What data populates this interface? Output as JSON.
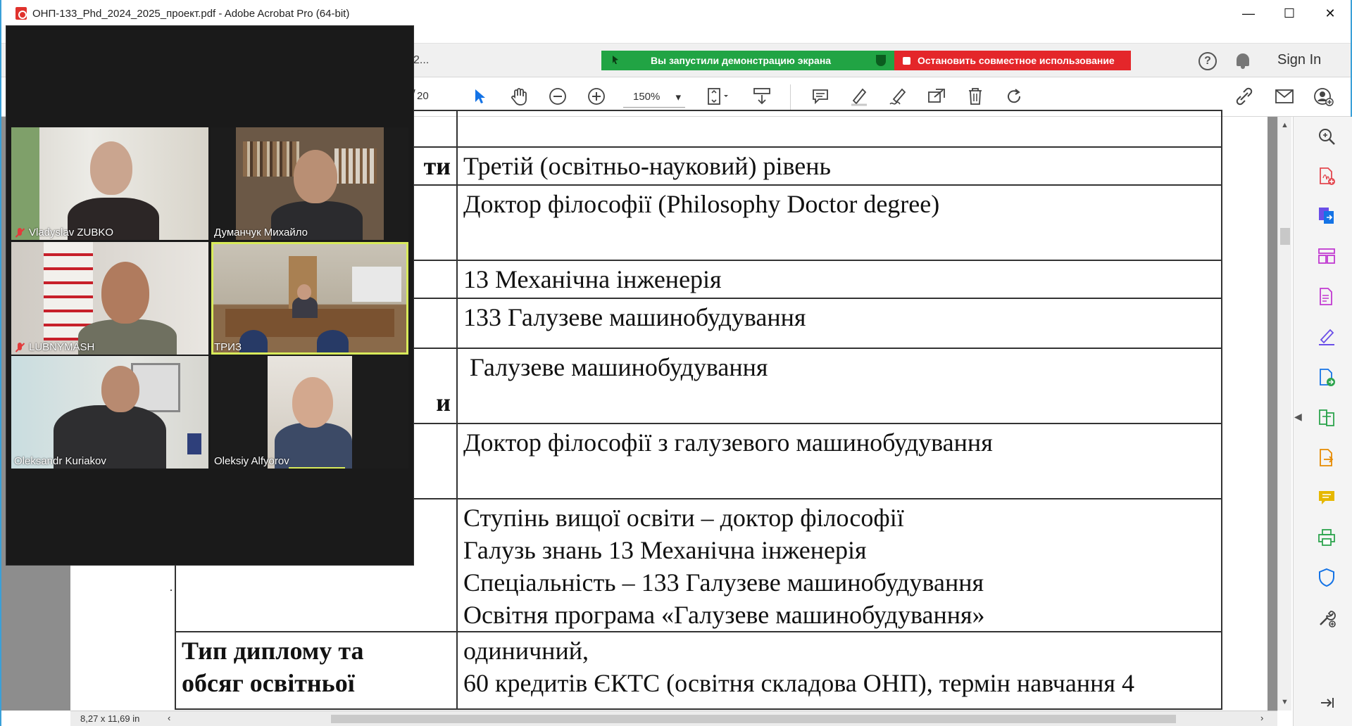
{
  "window": {
    "title": "ОНП-133_Phd_2024_2025_проект.pdf - Adobe Acrobat Pro (64-bit)",
    "minimize": "—",
    "maximize": "☐",
    "close": "✕"
  },
  "tabbar": {
    "doc_tab": "2...",
    "share_notice": "Вы запустили демонстрацию экрана",
    "stop_share": "Остановить совместное использование",
    "help": "?",
    "sign_in": "Sign In"
  },
  "toolbar": {
    "page_total": "20",
    "zoom_value": "150%",
    "zoom_arrow": "▾"
  },
  "document": {
    "rows": [
      {
        "left": "",
        "right": [
          ""
        ]
      },
      {
        "left": "ти",
        "right": [
          "Третій (освітньо-науковий) рівень"
        ]
      },
      {
        "left": "",
        "right": [
          "Доктор філософії (Philosophy Doctor degree)"
        ]
      },
      {
        "left": "",
        "right": [
          "13 Механічна інженерія"
        ]
      },
      {
        "left": "",
        "right": [
          "133 Галузеве машинобудування"
        ]
      },
      {
        "left": "и",
        "right": [
          " Галузеве машинобудування"
        ]
      },
      {
        "left": "",
        "right": [
          "Доктор філософії з галузевого машинобудування"
        ]
      },
      {
        "left": "",
        "right": [
          "Ступінь вищої освіти – доктор філософії",
          "Галузь знань 13 Механічна інженерія",
          "Спеціальність – 133 Галузеве машинобудування",
          "Освітня програма «Галузеве машинобудування»"
        ]
      },
      {
        "left_lines": [
          "Тип диплому та",
          "обсяг освітньої"
        ],
        "right": [
          "одиничний,",
          "60 кредитів ЄКТС (освітня складова ОНП), термін навчання 4"
        ]
      }
    ]
  },
  "statusbar": {
    "page_size": "8,27 x 11,69 in",
    "scroll_left": "‹",
    "scroll_right": "›"
  },
  "participants": [
    {
      "name": "Vladyslav ZUBKO",
      "muted": true
    },
    {
      "name": "Думанчук Михайло",
      "muted": false
    },
    {
      "name": "LUBNYMASH",
      "muted": true
    },
    {
      "name": "ТРИЗ",
      "muted": false,
      "active": true
    },
    {
      "name": "Oleksandr Kuriakov",
      "muted": false
    },
    {
      "name": "Oleksiy Alfyorov",
      "muted": false
    }
  ],
  "colors": {
    "accent_blue": "#1473e6",
    "share_green": "#21a444",
    "share_red": "#e4262a",
    "tool_red": "#e34850",
    "tool_pink": "#c13ad1",
    "tool_purple": "#6a4ee8",
    "tool_green": "#2da44e",
    "tool_orange": "#e68a00",
    "tool_yellow": "#e6b800"
  }
}
